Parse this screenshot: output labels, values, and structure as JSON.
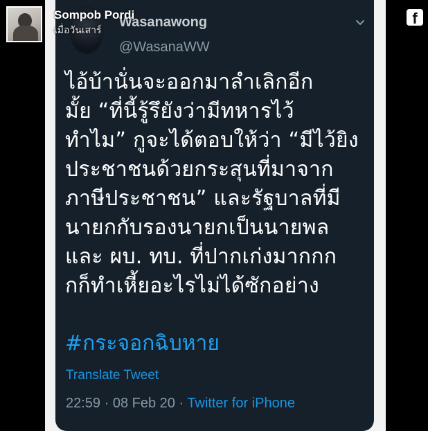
{
  "post": {
    "author_name": "Sompob Pordi",
    "date_label": "เมื่อวันเสาร์",
    "facebook_icon": "facebook-icon",
    "facebook_glyph": "f"
  },
  "tweet": {
    "display_name": "Wasanawong",
    "handle": "@WasanaWW",
    "body_lines": [
      "ไอ้บ้านั่นจะออกมาลำเลิกอีก",
      "มั้ย “ที่นี้รู้รึยังว่ามีทหารไว้",
      "ทำไม” กูจะได้ตอบให้ว่า “มีไว้ยิง",
      "ประชาชนด้วยกระสุนที่มาจาก",
      "ภาษีประชาชน” และรัฐบาลที่มี",
      "นายกกับรองนายกเป็นนายพล",
      "และ ผบ. ทบ. ที่ปากเก่งมากกก",
      "กก็ทำเหี้ยอะไรไม่ได้ซักอย่าง"
    ],
    "hashtag": "#กระจอกฉิบหาย",
    "translate_label": "Translate Tweet",
    "timestamp": "22:59 · 08 Feb 20 · ",
    "source": "Twitter for iPhone",
    "chevron_icon": "chevron-down-icon"
  },
  "colors": {
    "page_background": "#000000",
    "panel_background": "#f2f2f2",
    "tweet_background": "#15202b",
    "tweet_text": "#ffffff",
    "tweet_secondary": "#8899a6",
    "tweet_link": "#1da1f2"
  }
}
